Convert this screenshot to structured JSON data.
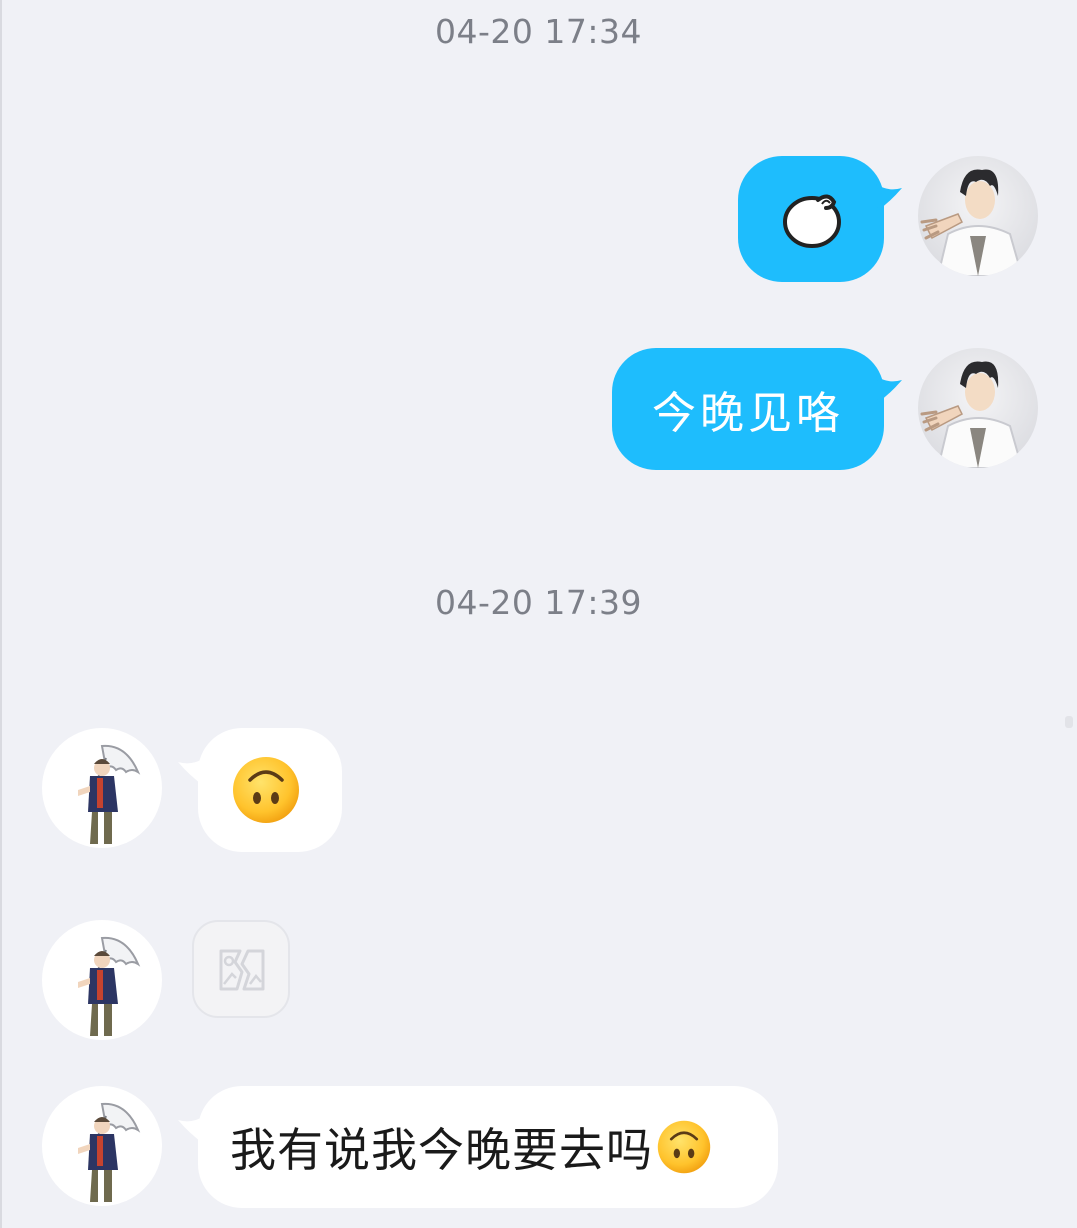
{
  "conversation": {
    "timestamps": [
      "04-20 17:34",
      "04-20 17:39"
    ],
    "outgoing": [
      {
        "type": "sticker",
        "sticker_icon": "round-bun-sticker-icon"
      },
      {
        "type": "text",
        "text": "今晚见咯"
      }
    ],
    "incoming": [
      {
        "type": "emoji",
        "emoji_icon": "upside-down-face-emoji-icon"
      },
      {
        "type": "image",
        "image_icon": "broken-image-icon"
      },
      {
        "type": "text",
        "text": "我有说我今晚要去吗",
        "trailing_emoji_icon": "upside-down-face-emoji-icon"
      }
    ]
  },
  "colors": {
    "background": "#f0f1f6",
    "outgoing_bubble": "#1ebdfd",
    "incoming_bubble": "#ffffff",
    "timestamp_text": "#7c7f88"
  }
}
